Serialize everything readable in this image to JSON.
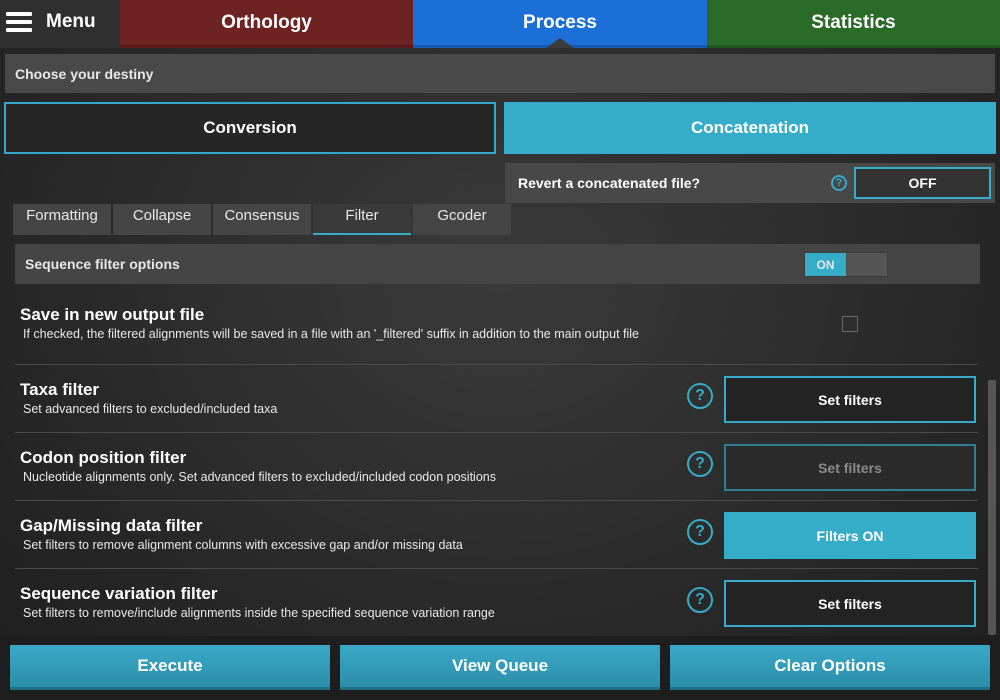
{
  "topbar": {
    "menu_label": "Menu",
    "tabs": [
      {
        "label": "Orthology",
        "color": "#6e2323"
      },
      {
        "label": "Process",
        "color": "#1c6fd6"
      },
      {
        "label": "Statistics",
        "color": "#2a6b2a"
      }
    ],
    "active_tab": "Process"
  },
  "header": {
    "destiny_label": "Choose your destiny",
    "modes": [
      {
        "label": "Conversion",
        "selected": false
      },
      {
        "label": "Concatenation",
        "selected": true
      }
    ],
    "revert_label": "Revert a concatenated file?",
    "revert_value": "OFF",
    "help_icon": "?"
  },
  "subtabs": {
    "items": [
      "Formatting",
      "Collapse",
      "Consensus",
      "Filter",
      "Gcoder"
    ],
    "active": "Filter"
  },
  "filter_panel": {
    "sequence_filter_label": "Sequence filter options",
    "sequence_filter_toggle": "ON",
    "save_output": {
      "title": "Save in new output file",
      "desc": "If checked, the filtered alignments will be saved in a file with an '_filtered' suffix in addition to the main output file",
      "checked": false
    },
    "rows": [
      {
        "title": "Taxa filter",
        "desc": "Set advanced filters to excluded/included taxa",
        "button": "Set filters",
        "state": "enabled"
      },
      {
        "title": "Codon position filter",
        "desc": "Nucleotide alignments only. Set advanced filters to excluded/included codon positions",
        "button": "Set filters",
        "state": "disabled"
      },
      {
        "title": "Gap/Missing data filter",
        "desc": "Set filters to remove alignment columns with excessive gap and/or missing data",
        "button": "Filters ON",
        "state": "active"
      },
      {
        "title": "Sequence variation filter",
        "desc": "Set filters to remove/include alignments inside the specified sequence variation range",
        "button": "Set filters",
        "state": "enabled"
      }
    ]
  },
  "bottom": {
    "execute": "Execute",
    "view_queue": "View Queue",
    "clear_options": "Clear Options"
  },
  "colors": {
    "accent": "#35acc8"
  }
}
